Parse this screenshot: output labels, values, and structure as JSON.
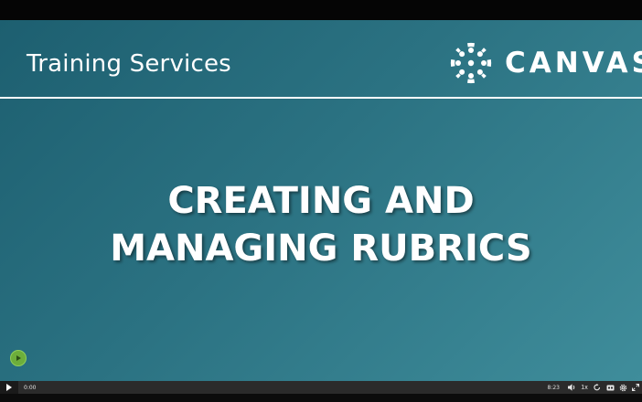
{
  "slide": {
    "title": "Training Services",
    "brand_name": "CANVAS",
    "headline_line1": "CREATING AND",
    "headline_line2": "MANAGING RUBRICS"
  },
  "player": {
    "current_time": "0:00",
    "duration": "8:23",
    "speed": "1x",
    "progress": 0,
    "icons": [
      "play-icon",
      "volume-icon",
      "replay-icon",
      "captions-icon",
      "settings-icon",
      "fullscreen-icon"
    ]
  },
  "colors": {
    "slide_bg_start": "#1d5f70",
    "slide_bg_end": "#3f8d9b",
    "control_bar": "#2b2b2b",
    "cursor_dot": "#6dae3b"
  }
}
